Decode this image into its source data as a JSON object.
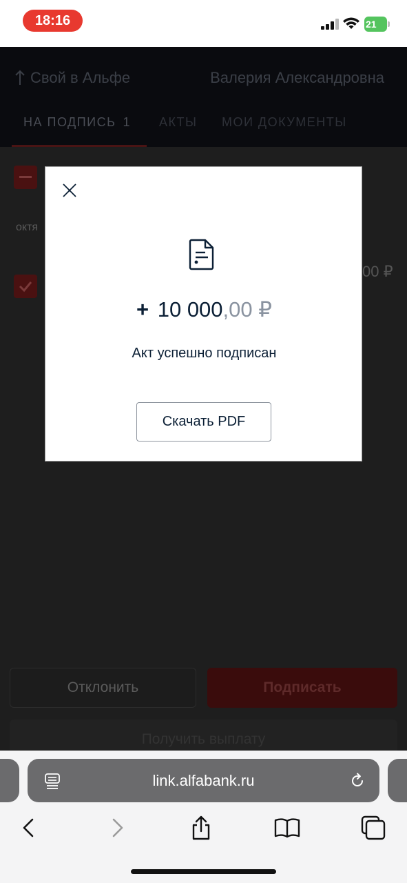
{
  "status_bar": {
    "time": "18:16",
    "battery": "21"
  },
  "header": {
    "back_label": "Свой в Альфе",
    "user_name": "Валерия Александровна"
  },
  "tabs": [
    {
      "label": "НА ПОДПИСЬ",
      "badge": "1",
      "active": true
    },
    {
      "label": "АКТЫ",
      "active": false
    },
    {
      "label": "МОИ ДОКУМЕНТЫ",
      "active": false
    }
  ],
  "content": {
    "month_label": "октя",
    "row_amount": "00 ₽"
  },
  "actions": {
    "decline_label": "Отклонить",
    "sign_label": "Подписать",
    "payout_label": "Получить выплату"
  },
  "modal": {
    "amount_prefix": "+",
    "amount_integer": "10 000",
    "amount_cents": ",00",
    "currency": "₽",
    "message": "Акт успешно подписан",
    "download_label": "Скачать PDF"
  },
  "browser": {
    "url": "link.alfabank.ru"
  },
  "colors": {
    "accent_red": "#ef3124",
    "text_dark": "#0b1f35",
    "overlay": "#1e1e1e"
  }
}
